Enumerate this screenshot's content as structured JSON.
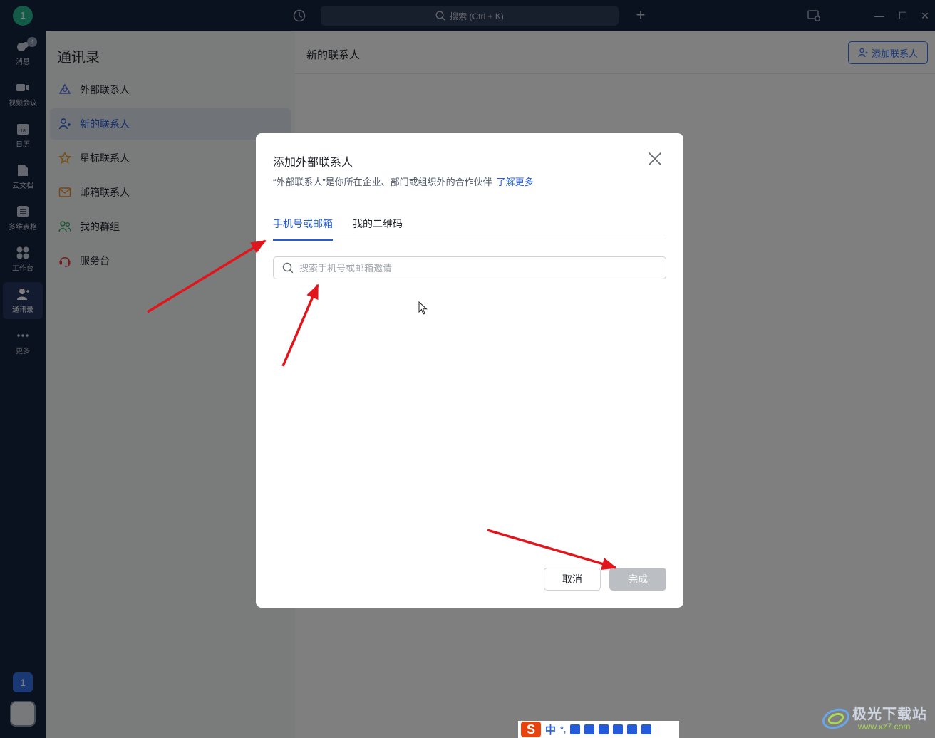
{
  "titlebar": {
    "avatar_text": "1",
    "search_placeholder": "搜索 (Ctrl + K)"
  },
  "rail": {
    "items": [
      {
        "label": "消息",
        "icon": "message-icon",
        "badge": "4"
      },
      {
        "label": "视频会议",
        "icon": "video-icon"
      },
      {
        "label": "日历",
        "icon": "calendar-icon",
        "day": "18"
      },
      {
        "label": "云文档",
        "icon": "doc-icon"
      },
      {
        "label": "多维表格",
        "icon": "table-icon"
      },
      {
        "label": "工作台",
        "icon": "workspace-icon"
      },
      {
        "label": "通讯录",
        "icon": "contacts-icon",
        "active": true
      },
      {
        "label": "更多",
        "icon": "more-icon"
      }
    ],
    "bottom_badge": "1"
  },
  "contacts": {
    "title": "通讯录",
    "items": [
      {
        "label": "外部联系人",
        "icon": "external-contacts-icon"
      },
      {
        "label": "新的联系人",
        "icon": "new-contact-icon",
        "active": true
      },
      {
        "label": "星标联系人",
        "icon": "star-icon"
      },
      {
        "label": "邮箱联系人",
        "icon": "mail-icon"
      },
      {
        "label": "我的群组",
        "icon": "group-icon"
      },
      {
        "label": "服务台",
        "icon": "helpdesk-icon"
      }
    ]
  },
  "main": {
    "title": "新的联系人",
    "add_button": "添加联系人"
  },
  "modal": {
    "title": "添加外部联系人",
    "description": "“外部联系人”是你所在企业、部门或组织外的合作伙伴",
    "learn_more": "了解更多",
    "tabs": [
      {
        "label": "手机号或邮箱",
        "active": true
      },
      {
        "label": "我的二维码",
        "active": false
      }
    ],
    "search_placeholder": "搜索手机号或邮箱邀请",
    "search_value": "",
    "cancel_label": "取消",
    "done_label": "完成"
  },
  "ime": {
    "logo": "S",
    "mode": "中",
    "punct": "°,"
  },
  "watermark": {
    "text": "极光下载站",
    "url": "www.xz7.com"
  },
  "colors": {
    "rail_bg": "#17243f",
    "accent": "#245bdb",
    "arrow": "#e0161c",
    "done_disabled": "#bbbfc4"
  }
}
